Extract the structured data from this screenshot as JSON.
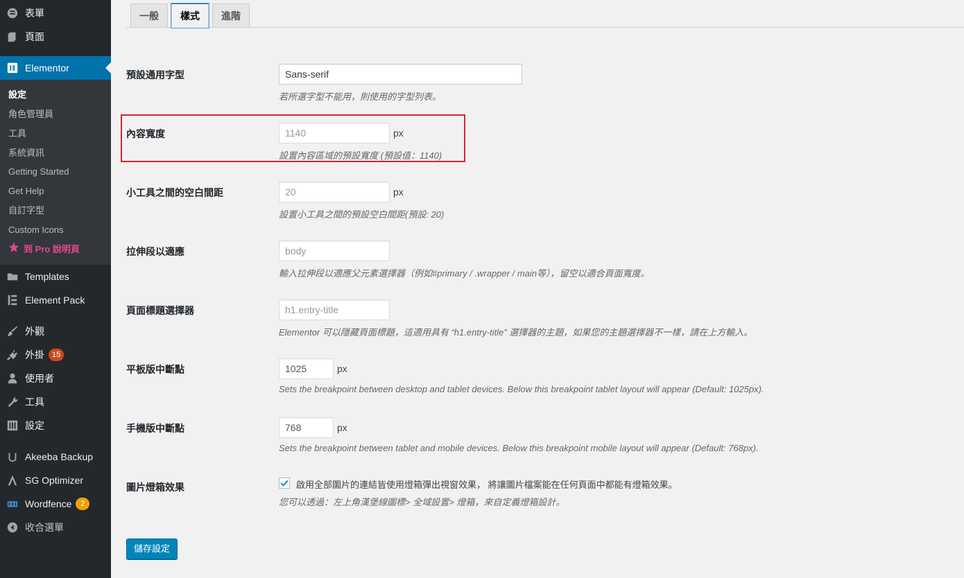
{
  "sidebar": {
    "top_items": [
      {
        "label": "表單",
        "icon": "form-icon"
      },
      {
        "label": "頁面",
        "icon": "pages-icon"
      }
    ],
    "current": {
      "label": "Elementor",
      "icon": "elementor-icon"
    },
    "submenu": [
      {
        "label": "設定"
      },
      {
        "label": "角色管理員"
      },
      {
        "label": "工具"
      },
      {
        "label": "系統資訊"
      },
      {
        "label": "Getting Started"
      },
      {
        "label": "Get Help"
      },
      {
        "label": "自訂字型"
      },
      {
        "label": "Custom Icons"
      },
      {
        "label": "到 Pro 說明頁"
      }
    ],
    "bottom_items": [
      {
        "label": "Templates",
        "icon": "folder-icon"
      },
      {
        "label": "Element Pack",
        "icon": "element-pack-icon"
      },
      {
        "label": "外觀",
        "icon": "paintbrush-icon"
      },
      {
        "label": "外掛",
        "icon": "plugin-icon",
        "badge": "15"
      },
      {
        "label": "使用者",
        "icon": "user-icon"
      },
      {
        "label": "工具",
        "icon": "wrench-icon"
      },
      {
        "label": "設定",
        "icon": "settings-icon"
      },
      {
        "label": "Akeeba Backup",
        "icon": "akeeba-icon"
      },
      {
        "label": "SG Optimizer",
        "icon": "sg-optimizer-icon"
      },
      {
        "label": "Wordfence",
        "icon": "wordfence-icon",
        "badge": "2"
      },
      {
        "label": "收合選單",
        "icon": "collapse-icon"
      }
    ],
    "colors": {
      "bg": "#23282d",
      "current": "#0073aa",
      "plugin_badge": "#ca4a1f",
      "wordfence_badge": "#f0a000",
      "pro": "#e2498a"
    }
  },
  "tabs": [
    {
      "label": "一般"
    },
    {
      "label": "樣式"
    },
    {
      "label": "進階"
    }
  ],
  "settings": {
    "default_font": {
      "label": "預設通用字型",
      "value": "Sans-serif",
      "desc": "若所選字型不能用，則使用的字型列表。"
    },
    "content_width": {
      "label": "內容寬度",
      "placeholder": "1140",
      "unit": "px",
      "desc": "設置內容區域的預設寬度 (預設值：1140)"
    },
    "widget_space": {
      "label": "小工具之間的空白間距",
      "placeholder": "20",
      "unit": "px",
      "desc": "設置小工具之間的預設空白間距(預設: 20)"
    },
    "stretch_section": {
      "label": "拉伸段以適應",
      "placeholder": "body",
      "desc": "輸入拉伸段以適應父元素選擇器（例如#primary / .wrapper / main等），留空以適合頁面寬度。"
    },
    "page_title_selector": {
      "label": "頁面標題選擇器",
      "placeholder": "h1.entry-title",
      "desc": "Elementor 可以隱藏頁面標題，這適用具有 “h1.entry-title” 選擇器的主題，如果您的主題選擇器不一樣，請在上方輸入。"
    },
    "tablet_breakpoint": {
      "label": "平板版中斷點",
      "value": "1025",
      "unit": "px",
      "desc": "Sets the breakpoint between desktop and tablet devices. Below this breakpoint tablet layout will appear (Default: 1025px)."
    },
    "mobile_breakpoint": {
      "label": "手機版中斷點",
      "value": "768",
      "unit": "px",
      "desc": "Sets the breakpoint between tablet and mobile devices. Below this breakpoint mobile layout will appear (Default: 768px)."
    },
    "lightbox": {
      "label": "圖片燈箱效果",
      "checkbox_label": "啟用全部圖片的連結皆使用燈箱彈出視窗效果， 將讓圖片檔案能在任何頁面中都能有燈箱效果。",
      "checked": true,
      "desc": "您可以透過：左上角漢堡線圖標> 全域設置> 燈箱，來自定義燈箱設計。"
    }
  },
  "save_button": {
    "label": "儲存設定"
  }
}
